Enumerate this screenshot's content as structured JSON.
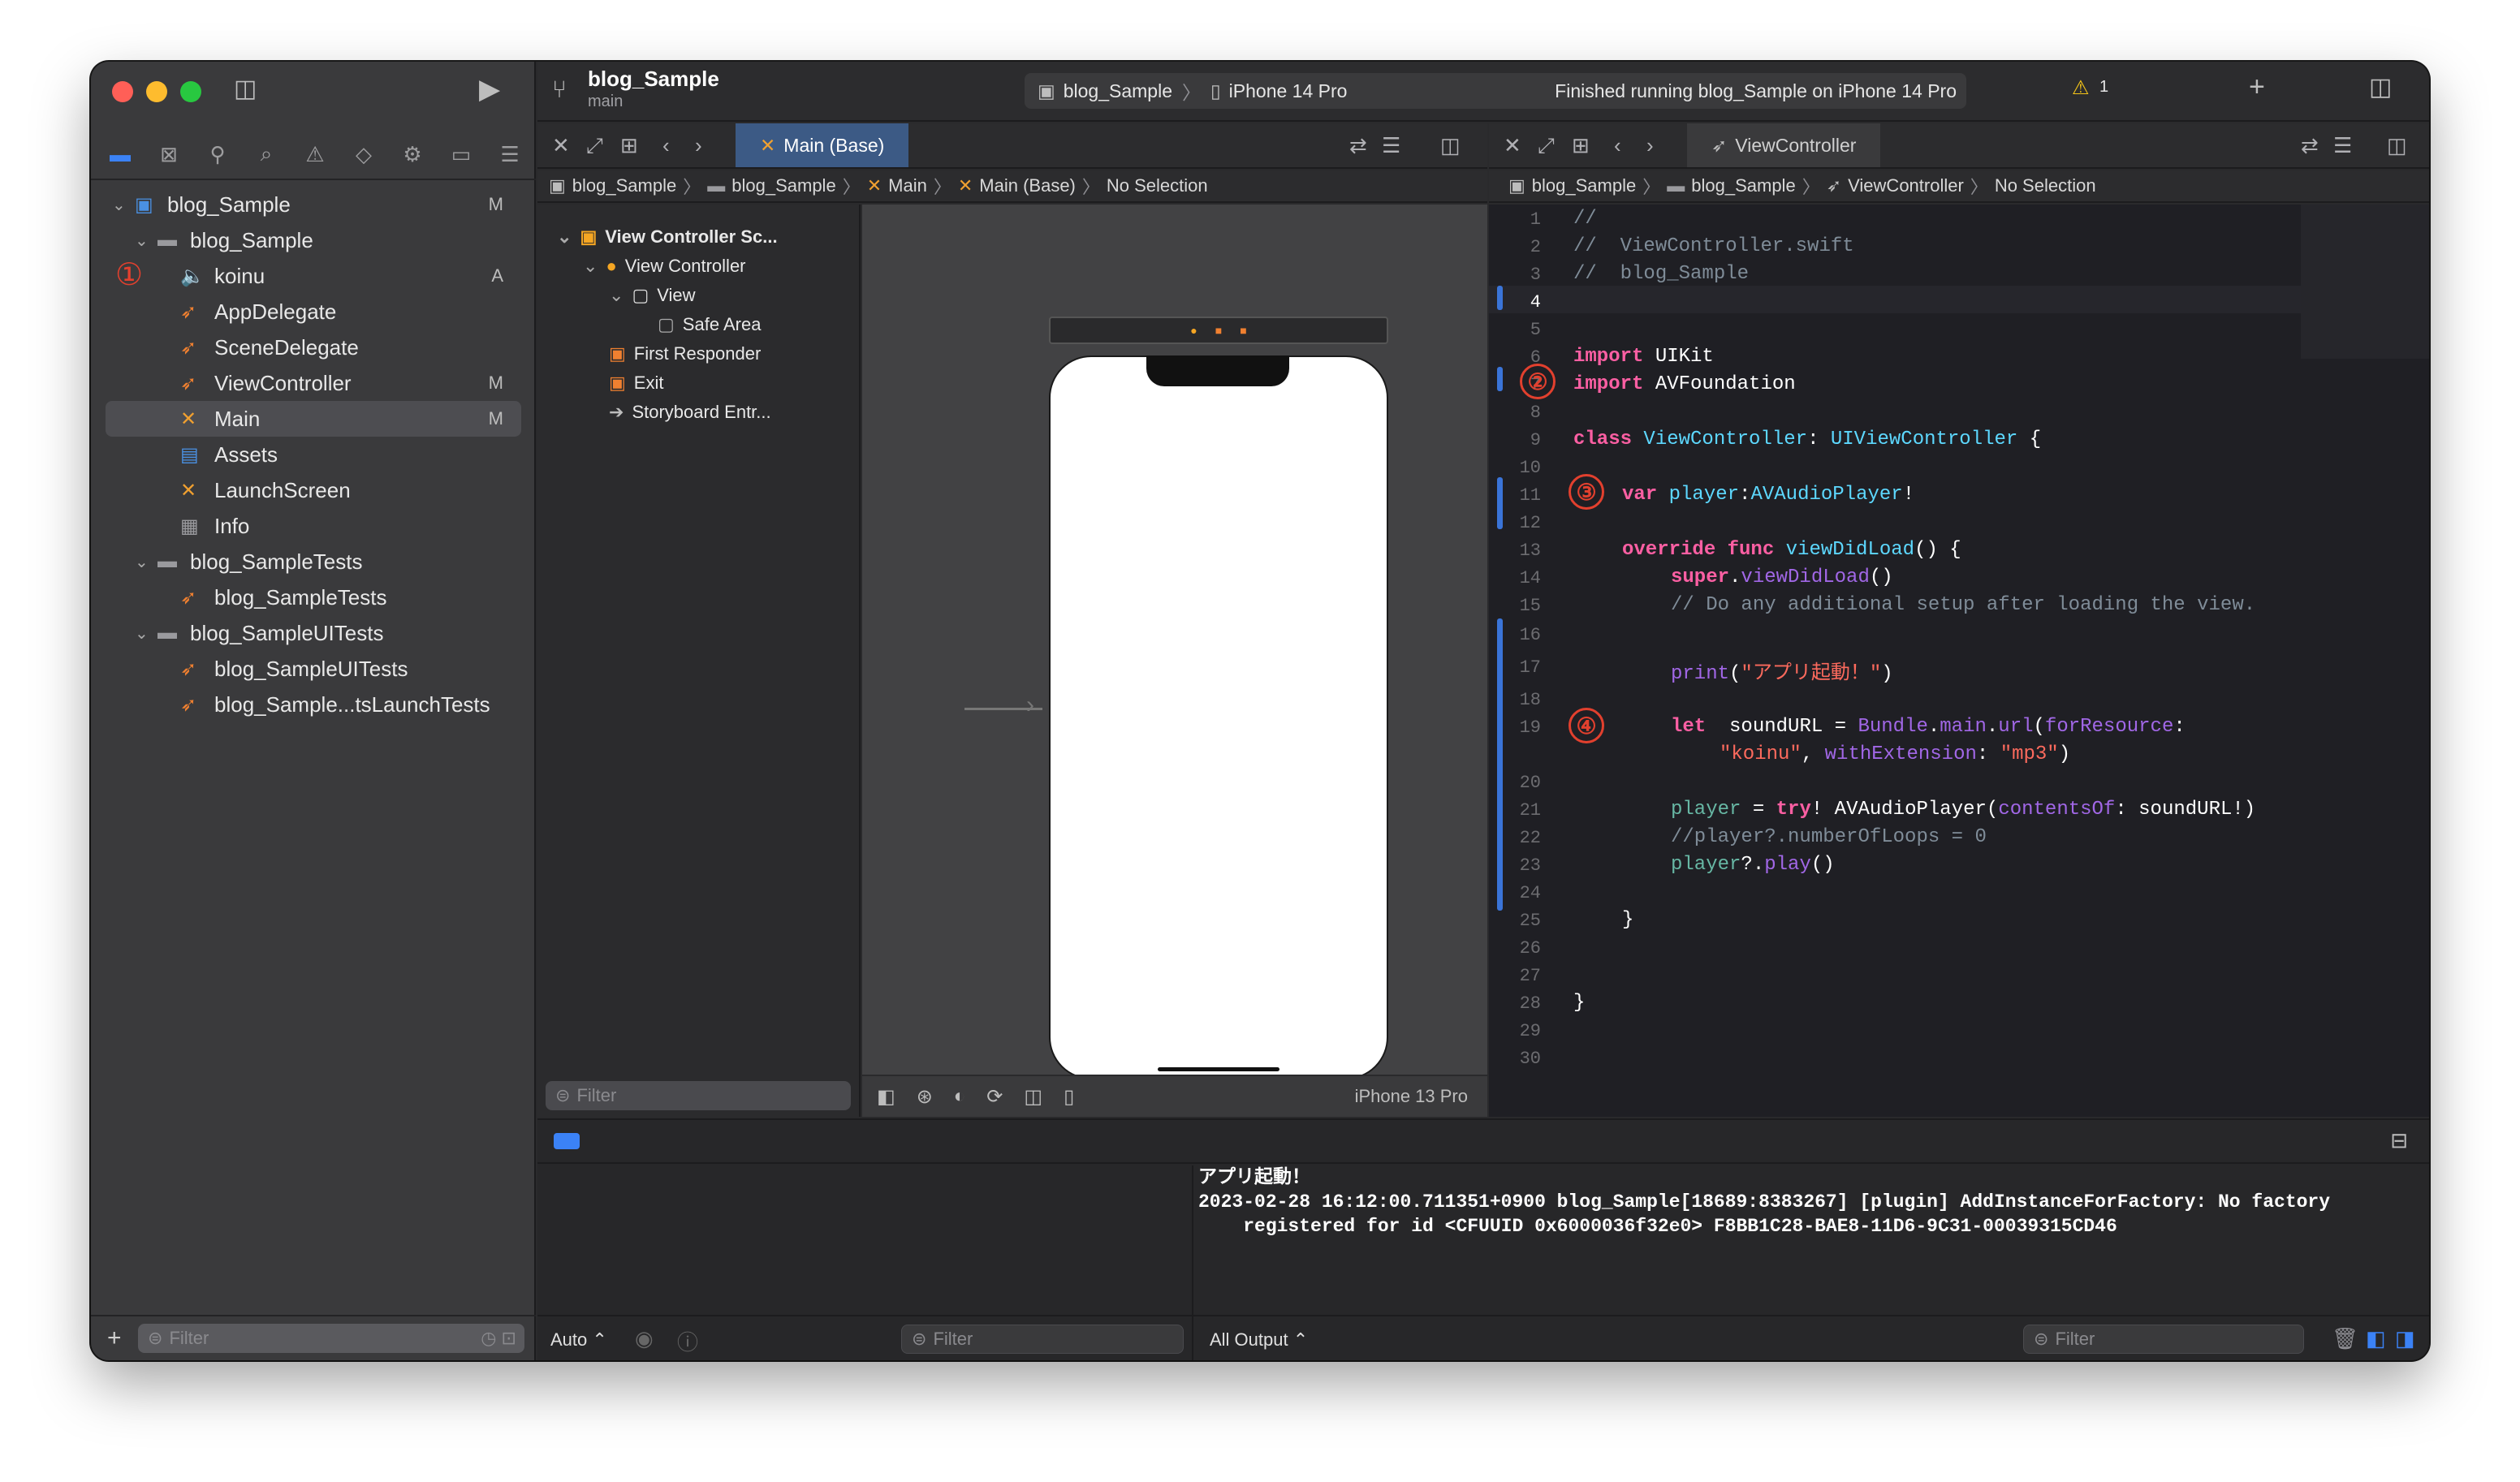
{
  "colors": {
    "accent": "#3b82f6",
    "annotation": "#e2402e",
    "change_bar": "#3a74d8"
  },
  "navigator": {
    "filter_placeholder": "Filter",
    "items": [
      {
        "label": "blog_Sample",
        "status": "M",
        "icon": "project-icon"
      },
      {
        "label": "blog_Sample",
        "status": "",
        "icon": "folder-icon"
      },
      {
        "label": "koinu",
        "status": "A",
        "icon": "audio-file-icon"
      },
      {
        "label": "AppDelegate",
        "status": "",
        "icon": "swift-file-icon"
      },
      {
        "label": "SceneDelegate",
        "status": "",
        "icon": "swift-file-icon"
      },
      {
        "label": "ViewController",
        "status": "M",
        "icon": "swift-file-icon"
      },
      {
        "label": "Main",
        "status": "M",
        "icon": "storyboard-icon"
      },
      {
        "label": "Assets",
        "status": "",
        "icon": "assets-icon"
      },
      {
        "label": "LaunchScreen",
        "status": "",
        "icon": "storyboard-icon"
      },
      {
        "label": "Info",
        "status": "",
        "icon": "plist-icon"
      },
      {
        "label": "blog_SampleTests",
        "status": "",
        "icon": "folder-icon"
      },
      {
        "label": "blog_SampleTests",
        "status": "",
        "icon": "swift-file-icon"
      },
      {
        "label": "blog_SampleUITests",
        "status": "",
        "icon": "folder-icon"
      },
      {
        "label": "blog_SampleUITests",
        "status": "",
        "icon": "swift-file-icon"
      },
      {
        "label": "blog_Sample...tsLaunchTests",
        "status": "",
        "icon": "swift-file-icon"
      }
    ],
    "annotation_1": "①"
  },
  "toolbar": {
    "project": "blog_Sample",
    "branch": "main",
    "scheme": "blog_Sample",
    "device": "iPhone 14 Pro",
    "status": "Finished running blog_Sample on iPhone 14 Pro",
    "warnings": "1"
  },
  "left_editor": {
    "tab": "Main (Base)",
    "breadcrumb": [
      "blog_Sample",
      "blog_Sample",
      "Main",
      "Main (Base)",
      "No Selection"
    ],
    "outline": [
      "View Controller Sc...",
      "View Controller",
      "View",
      "Safe Area",
      "First Responder",
      "Exit",
      "Storyboard Entr..."
    ],
    "filter_placeholder": "Filter",
    "device_label": "iPhone 13 Pro"
  },
  "right_editor": {
    "tab": "ViewController",
    "breadcrumb": [
      "blog_Sample",
      "blog_Sample",
      "ViewController",
      "No Selection"
    ],
    "line_numbers": [
      "1",
      "2",
      "3",
      "4",
      "5",
      "6",
      "7",
      "8",
      "9",
      "10",
      "11",
      "12",
      "13",
      "14",
      "15",
      "16",
      "17",
      "18",
      "19",
      "",
      "20",
      "21",
      "22",
      "23",
      "24",
      "25",
      "26",
      "27",
      "28",
      "29",
      "30"
    ],
    "code": {
      "l1": "//",
      "l2": "//  ViewController.swift",
      "l3": "//  blog_Sample",
      "l6a": "import",
      "l6b": " UIKit",
      "l7a": "import",
      "l7b": " AVFoundation",
      "l9a": "class",
      "l9b": " ViewController",
      "l9c": ": ",
      "l9d": "UIViewController",
      "l9e": " {",
      "l11a": "var",
      "l11b": " player",
      "l11c": ":",
      "l11d": "AVAudioPlayer",
      "l11e": "!",
      "l13a": "override",
      "l13b": " func",
      "l13c": " viewDidLoad",
      "l13d": "() {",
      "l14a": "super",
      "l14b": ".",
      "l14c": "viewDidLoad",
      "l14d": "()",
      "l15": "// Do any additional setup after loading the view.",
      "l17a": "print",
      "l17b": "(",
      "l17c": "\"アプリ起動！\"",
      "l17d": ")",
      "l19a": "let",
      "l19b": "  soundURL = ",
      "l19c": "Bundle",
      "l19d": ".",
      "l19e": "main",
      "l19f": ".",
      "l19g": "url",
      "l19h": "(",
      "l19i": "forResource",
      "l19j": ":",
      "l19k": "\"koinu\"",
      "l19l": ", ",
      "l19m": "withExtension",
      "l19n": ": ",
      "l19o": "\"mp3\"",
      "l19p": ")",
      "l21a": "player",
      "l21b": " = ",
      "l21c": "try",
      "l21d": "! ",
      "l21e": "AVAudioPlayer",
      "l21f": "(",
      "l21g": "contentsOf",
      "l21h": ": soundURL!)",
      "l22": "//player?.numberOfLoops = 0",
      "l23a": "player",
      "l23b": "?.",
      "l23c": "play",
      "l23d": "()",
      "l25": "}",
      "l28": "}"
    },
    "annotations": [
      "②",
      "③",
      "④"
    ]
  },
  "debug": {
    "console_lines": [
      "アプリ起動！",
      "2023-02-28 16:12:00.711351+0900 blog_Sample[18689:8383267] [plugin] AddInstanceForFactory: No factory",
      "    registered for id <CFUUID 0x6000036f32e0> F8BB1C28-BAE8-11D6-9C31-00039315CD46"
    ],
    "auto_label": "Auto ⌃",
    "filter_placeholder": "Filter",
    "output_label": "All Output ⌃",
    "console_filter_placeholder": "Filter"
  }
}
